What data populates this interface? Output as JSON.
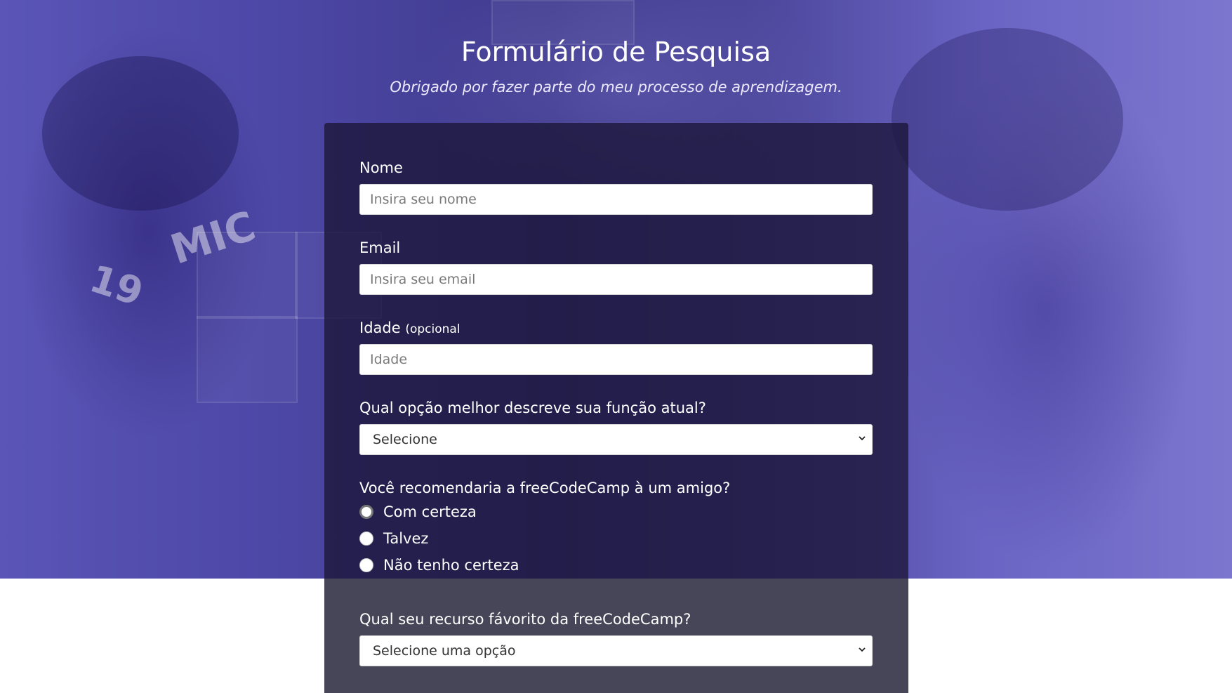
{
  "header": {
    "title": "Formulário de Pesquisa",
    "description": "Obrigado por fazer parte do meu processo de aprendizagem."
  },
  "background": {
    "shirt_text": "MIC",
    "shirt_number": "19"
  },
  "form": {
    "name": {
      "label": "Nome",
      "placeholder": "Insira seu nome"
    },
    "email": {
      "label": "Email",
      "placeholder": "Insira seu email"
    },
    "age": {
      "label": "Idade",
      "clue": "(opcional",
      "placeholder": "Idade"
    },
    "role": {
      "label": "Qual opção melhor descreve sua função atual?",
      "selected": "Selecione"
    },
    "recommend": {
      "label": "Você recomendaria a freeCodeCamp à um amigo?",
      "options": [
        "Com certeza",
        "Talvez",
        "Não tenho certeza"
      ]
    },
    "favorite": {
      "label": "Qual seu recurso fávorito da freeCodeCamp?",
      "selected": "Selecione uma opção"
    }
  },
  "icons": {
    "select_arrow": "chevron-down-icon"
  },
  "colors": {
    "hero_overlay": "#4e49a8",
    "card_background": "#1b173a",
    "card_lower": "#474558"
  }
}
